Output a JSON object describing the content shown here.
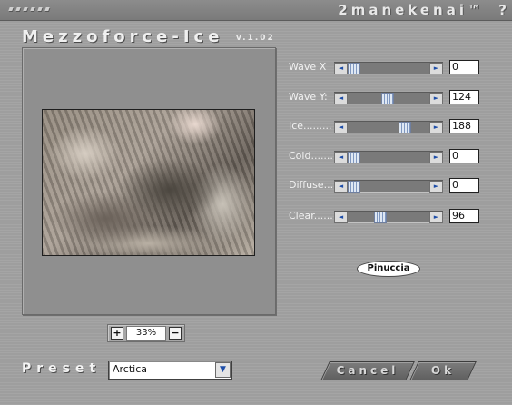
{
  "header": {
    "brand": "2manekenai™",
    "help": "?"
  },
  "plugin": {
    "title": "Mezzoforce-Ice",
    "version": "v.1.02"
  },
  "zoom": {
    "level": "33%",
    "in_glyph": "+",
    "out_glyph": "−"
  },
  "parameters": [
    {
      "label": "Wave X",
      "value": "0",
      "position": 0.0
    },
    {
      "label": "Wave Y:",
      "value": "124",
      "position": 0.49
    },
    {
      "label": "Ice.........",
      "value": "188",
      "position": 0.74
    },
    {
      "label": "Cold.......",
      "value": "0",
      "position": 0.0
    },
    {
      "label": "Diffuse...",
      "value": "0",
      "position": 0.0
    },
    {
      "label": "Clear......",
      "value": "96",
      "position": 0.38
    }
  ],
  "signature": "Pinuccia",
  "preset": {
    "label": "Preset",
    "value": "Arctica"
  },
  "buttons": {
    "cancel": "Cancel",
    "ok": "Ok"
  },
  "icons": {
    "arrow_left": "arrow-left-icon",
    "arrow_right": "arrow-right-icon",
    "dropdown": "chevron-down-icon"
  },
  "colors": {
    "background": "#9e9e9e",
    "slider_thumb": "#7f97bf",
    "arrow_glyph": "#1d4da8"
  }
}
